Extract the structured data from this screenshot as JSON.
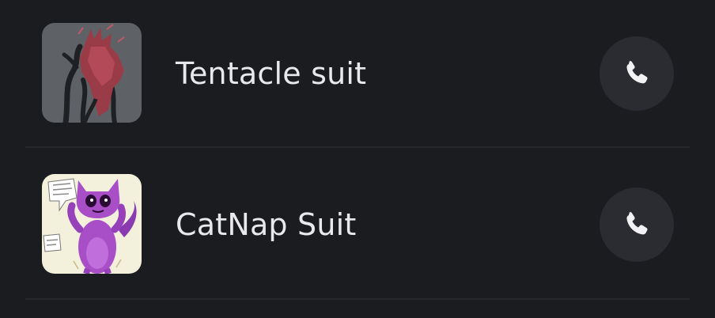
{
  "contacts": [
    {
      "name": "Tentacle suit",
      "avatar_icon": "tentacle-suit-avatar",
      "call_icon": "phone-icon"
    },
    {
      "name": "CatNap Suit",
      "avatar_icon": "catnap-suit-avatar",
      "call_icon": "phone-icon"
    }
  ],
  "colors": {
    "background": "#1b1c1f",
    "call_button": "#2a2c31",
    "divider": "#26282c",
    "text": "#e9e9ec"
  }
}
